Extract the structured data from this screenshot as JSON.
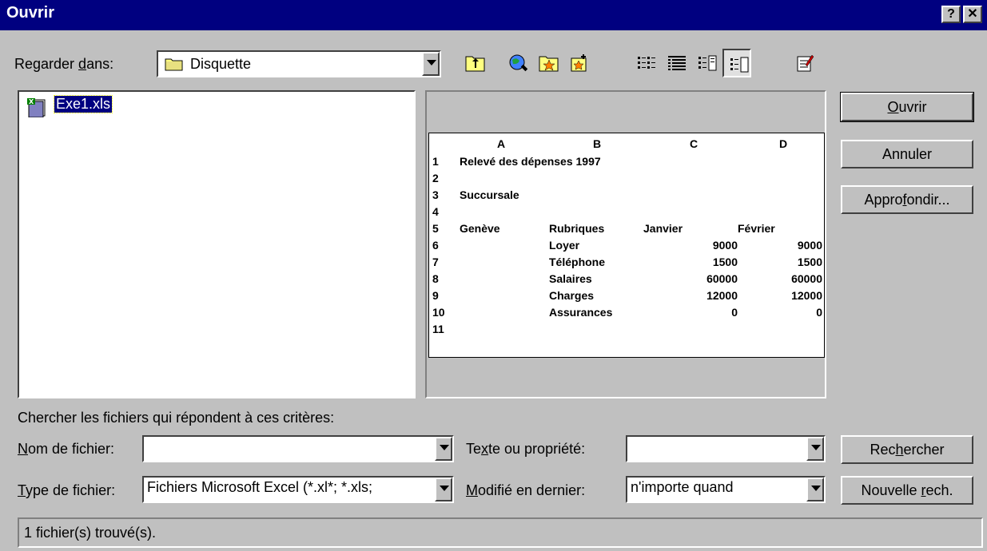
{
  "window": {
    "title": "Ouvrir",
    "help_label": "?",
    "close_label": "✕"
  },
  "look_in": {
    "label_pre": "Regarder ",
    "label_u": "d",
    "label_post": "ans:",
    "value": "Disquette"
  },
  "toolbar": {
    "icons": [
      "up-one-level-icon",
      "search-web-icon",
      "look-in-favorites-icon",
      "add-to-favorites-icon",
      "list-view-icon",
      "details-view-icon",
      "properties-view-icon",
      "preview-view-icon",
      "commands-settings-icon"
    ],
    "pressed": "preview-view-icon"
  },
  "files": [
    {
      "name": "Exe1.xls",
      "icon": "excel-file-icon",
      "selected": true
    }
  ],
  "preview": {
    "columns": [
      "A",
      "B",
      "C",
      "D"
    ],
    "rows": [
      {
        "n": "1",
        "a": "Relevé des dépenses 1997",
        "b": "",
        "c": "",
        "d": ""
      },
      {
        "n": "2",
        "a": "",
        "b": "",
        "c": "",
        "d": ""
      },
      {
        "n": "3",
        "a": "Succursale",
        "b": "",
        "c": "",
        "d": ""
      },
      {
        "n": "4",
        "a": "",
        "b": "",
        "c": "",
        "d": ""
      },
      {
        "n": "5",
        "a": "Genève",
        "b": "Rubriques",
        "c": "Janvier",
        "d": "Février"
      },
      {
        "n": "6",
        "a": "",
        "b": "Loyer",
        "c": "9000",
        "d": "9000"
      },
      {
        "n": "7",
        "a": "",
        "b": "Téléphone",
        "c": "1500",
        "d": "1500"
      },
      {
        "n": "8",
        "a": "",
        "b": "Salaires",
        "c": "60000",
        "d": "60000"
      },
      {
        "n": "9",
        "a": "",
        "b": "Charges",
        "c": "12000",
        "d": "12000"
      },
      {
        "n": "10",
        "a": "",
        "b": "Assurances",
        "c": "0",
        "d": "0"
      },
      {
        "n": "11",
        "a": "",
        "b": "",
        "c": "",
        "d": ""
      }
    ]
  },
  "buttons": {
    "open": {
      "u": "O",
      "rest": "uvrir"
    },
    "cancel": "Annuler",
    "advanced": {
      "pre": "Appro",
      "u": "f",
      "post": "ondir..."
    },
    "search": {
      "pre": "Rec",
      "u": "h",
      "post": "ercher"
    },
    "new_search": {
      "pre": "Nouvelle ",
      "u": "r",
      "post": "ech."
    }
  },
  "criteria": {
    "heading": "Chercher les fichiers qui répondent à ces critères:",
    "filename": {
      "u": "N",
      "rest": "om de fichier:",
      "value": ""
    },
    "filetype": {
      "u": "T",
      "rest": "ype de fichier:",
      "value": "Fichiers Microsoft Excel (*.xl*; *.xls;"
    },
    "text_prop": {
      "pre": "Te",
      "u": "x",
      "post": "te ou propriété:",
      "value": ""
    },
    "modified": {
      "u": "M",
      "rest": "odifié en dernier:",
      "value": "n'importe quand"
    }
  },
  "status": "1 fichier(s) trouvé(s)."
}
